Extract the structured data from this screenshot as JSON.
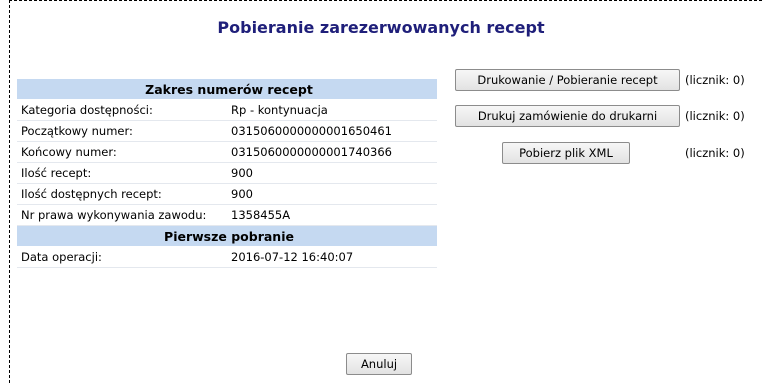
{
  "page": {
    "title": "Pobieranie zarezerwowanych recept"
  },
  "details": {
    "section_range": "Zakres numerów recept",
    "rows": [
      {
        "label": "Kategoria dostępności:",
        "value": "Rp - kontynuacja"
      },
      {
        "label": "Początkowy numer:",
        "value": "0315060000000001650461"
      },
      {
        "label": "Końcowy numer:",
        "value": "0315060000000001740366"
      },
      {
        "label": "Ilość recept:",
        "value": "900"
      },
      {
        "label": "Ilość dostępnych recept:",
        "value": "900"
      },
      {
        "label": "Nr prawa wykonywania zawodu:",
        "value": "1358455A"
      }
    ],
    "section_first": "Pierwsze pobranie",
    "first_rows": [
      {
        "label": "Data operacji:",
        "value": "2016-07-12 16:40:07"
      }
    ]
  },
  "actions": {
    "print_download_label": "Drukowanie / Pobieranie recept",
    "print_download_counter": "(licznik: 0)",
    "print_order_label": "Drukuj zamówienie do drukarni",
    "print_order_counter": "(licznik: 0)",
    "xml_label": "Pobierz plik XML",
    "xml_counter": "(licznik: 0)",
    "cancel_label": "Anuluj"
  }
}
